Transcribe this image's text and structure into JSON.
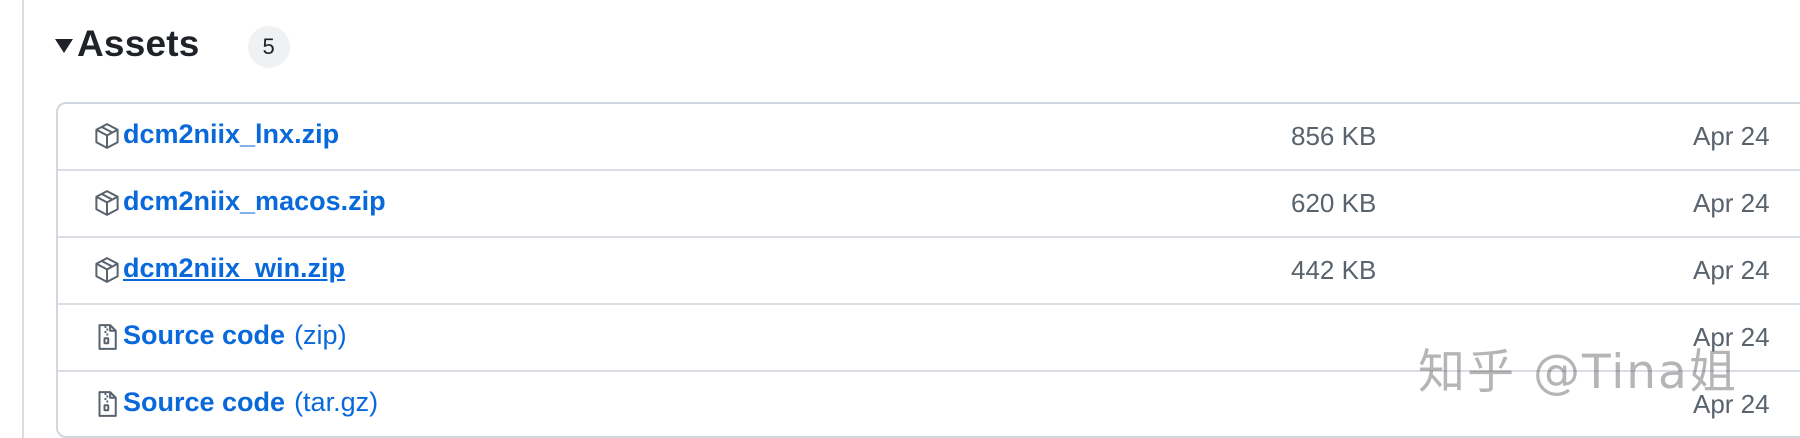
{
  "assets_section": {
    "title": "Assets",
    "count": "5",
    "caret_icon": "triangle-down-icon"
  },
  "assets": [
    {
      "name": "dcm2niix_lnx.zip",
      "suffix": "",
      "size": "856 KB",
      "date": "Apr 24",
      "icon": "package-icon"
    },
    {
      "name": "dcm2niix_macos.zip",
      "suffix": "",
      "size": "620 KB",
      "date": "Apr 24",
      "icon": "package-icon"
    },
    {
      "name": "dcm2niix_win.zip",
      "suffix": "",
      "size": "442 KB",
      "date": "Apr 24",
      "icon": "package-icon"
    },
    {
      "name": "Source code",
      "suffix": "(zip)",
      "size": "",
      "date": "Apr 24",
      "icon": "file-zip-icon"
    },
    {
      "name": "Source code",
      "suffix": "(tar.gz)",
      "size": "",
      "date": "Apr 24",
      "icon": "file-zip-icon"
    }
  ],
  "watermark": "知乎 @Tina姐",
  "colors": {
    "link": "#0969da",
    "muted_text": "#59636e",
    "border": "#d0d7de",
    "badge_bg": "#eff1f3"
  }
}
